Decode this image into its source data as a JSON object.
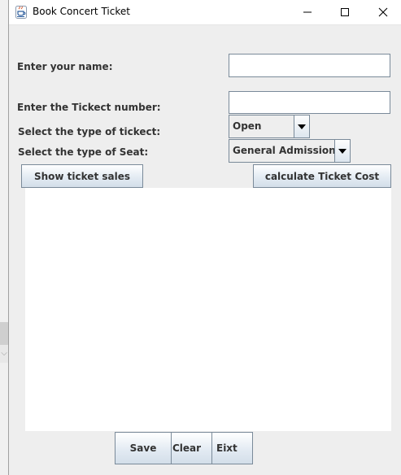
{
  "window": {
    "title": "Book Concert Ticket",
    "icon": "java-cup-icon",
    "controls": {
      "minimize": "minimize-icon",
      "maximize": "maximize-icon",
      "close": "close-icon"
    }
  },
  "form": {
    "name_label": "Enter your name:",
    "name_value": "",
    "ticket_number_label": "Enter the Tickect number:",
    "ticket_number_value": "",
    "ticket_type_label": "Select the type of tickect:",
    "ticket_type_selected": "Open",
    "seat_type_label": "Select the type of Seat:",
    "seat_type_selected": "General Admission"
  },
  "buttons": {
    "show_sales": "Show ticket sales",
    "calculate_cost": "calculate Ticket Cost",
    "save": "Save",
    "clear": "Clear",
    "exit": "Eixt"
  },
  "output": {
    "text": ""
  },
  "colors": {
    "window_bg": "#eeeeee",
    "border": "#7a8a99",
    "label_text": "#333333",
    "button_gradient_bottom": "#d3dee9"
  }
}
